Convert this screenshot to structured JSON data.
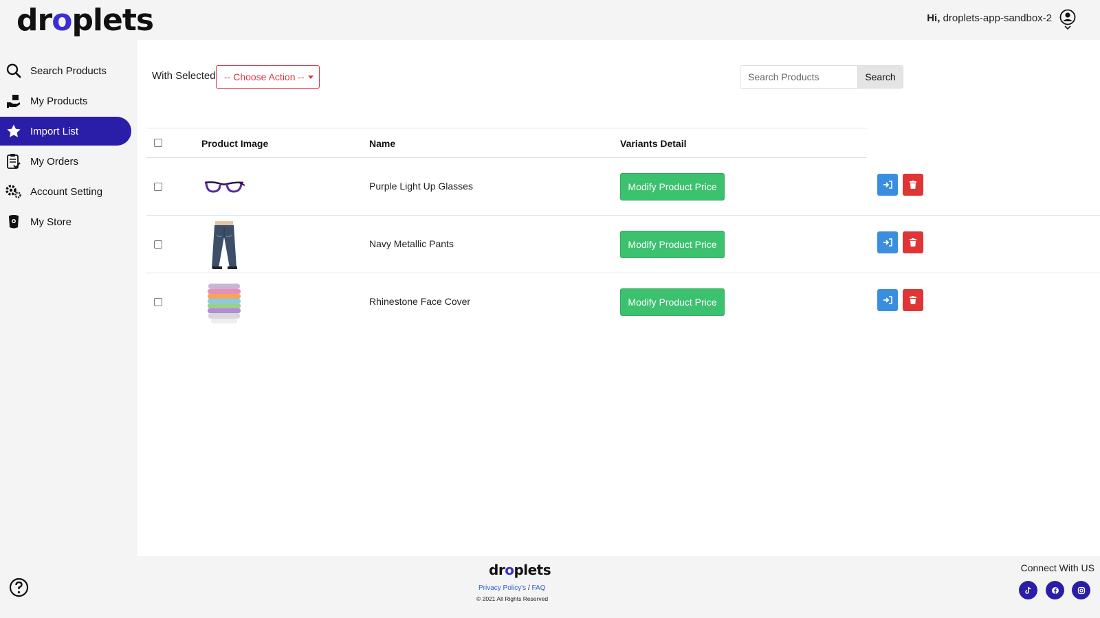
{
  "header": {
    "logo_text_a": "dr",
    "logo_text_b": "o",
    "logo_text_c": "plets",
    "greeting_prefix": "Hi,",
    "username": "droplets-app-sandbox-2"
  },
  "sidebar": {
    "items": [
      {
        "label": "Search Products",
        "icon": "search-icon"
      },
      {
        "label": "My Products",
        "icon": "hand-box-icon"
      },
      {
        "label": "Import List",
        "icon": "star-icon",
        "active": true
      },
      {
        "label": "My Orders",
        "icon": "clipboard-check-icon"
      },
      {
        "label": "Account Setting",
        "icon": "gear-icon"
      },
      {
        "label": "My Store",
        "icon": "store-icon"
      }
    ],
    "active_color": "#2a1ea8"
  },
  "toolbar": {
    "with_selected_label": "With Selected:",
    "action_select_label": "-- Choose Action --",
    "search_placeholder": "Search Products",
    "search_button": "Search"
  },
  "table": {
    "columns": [
      "Product Image",
      "Name",
      "Variants Detail"
    ],
    "rows": [
      {
        "name": "Purple Light Up Glasses",
        "image": "glasses-image",
        "action_label": "Modify Product Price"
      },
      {
        "name": "Navy Metallic Pants",
        "image": "jeans-image",
        "action_label": "Modify Product Price"
      },
      {
        "name": "Rhinestone Face Cover",
        "image": "face-cover-image",
        "action_label": "Modify Product Price"
      }
    ]
  },
  "footer": {
    "logo_text_a": "dr",
    "logo_text_b": "o",
    "logo_text_c": "plets",
    "privacy_link": "Privacy Policy's",
    "separator": "/",
    "faq_link": "FAQ",
    "copyright": "© 2021 All Rights Reserved",
    "connect_label": "Connect With US",
    "social": [
      "tiktok-icon",
      "facebook-icon",
      "instagram-icon"
    ]
  },
  "colors": {
    "brand": "#2a1ea8",
    "success": "#3cc16e",
    "danger": "#e03535",
    "info": "#3a8ee0"
  }
}
